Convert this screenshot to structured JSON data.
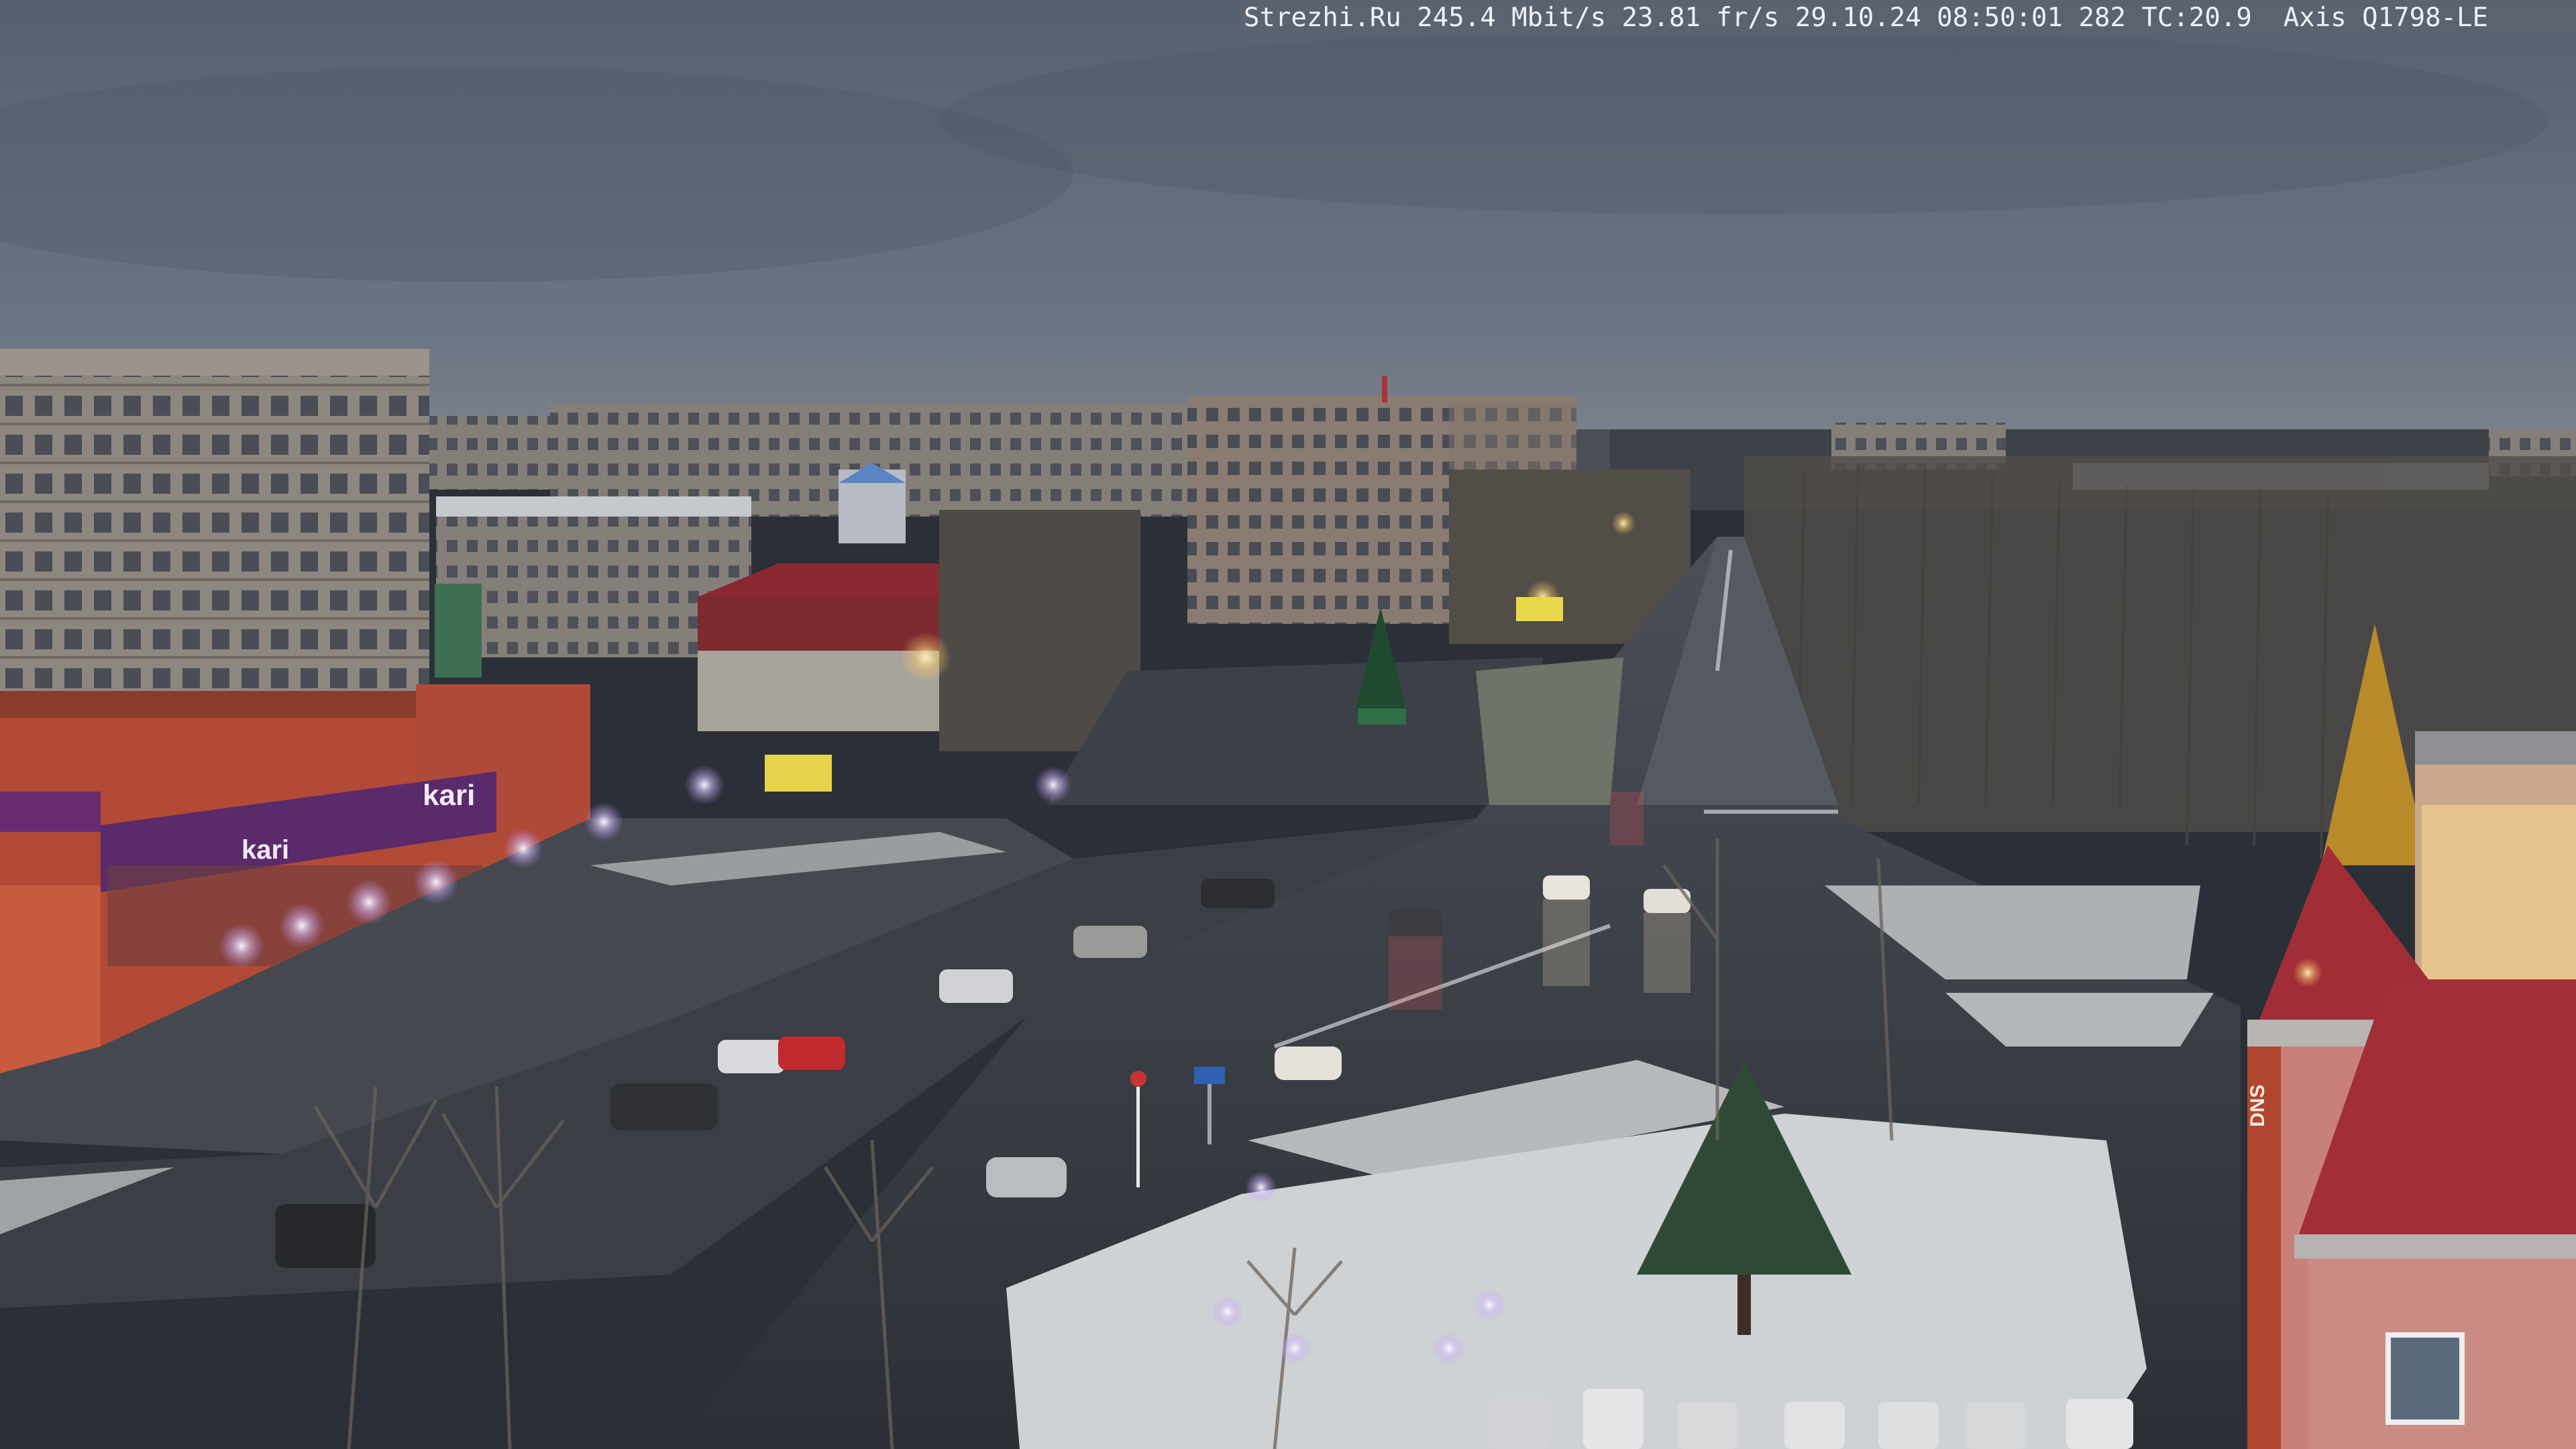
{
  "osd": {
    "site": "Strezhi.Ru",
    "bitrate": "245.4 Mbit/s",
    "framerate": "23.81 fr/s",
    "date": "29.10.24",
    "time": "08:50:01",
    "frame_counter": "282",
    "temperature": "TC:20.9",
    "camera_model": "Axis Q1798-LE"
  },
  "scene": {
    "signs": {
      "store_left": "kari",
      "store_main": "kari",
      "dns_tower": "DNS"
    }
  },
  "colors": {
    "sky": "#5f6878",
    "sky_horizon": "#7a8290",
    "asphalt": "#3a3e45",
    "wet_asphalt": "#2f3339",
    "snow": "#c9ccd0",
    "brick_red": "#b24a36",
    "store_purple": "#5a2a6a",
    "roof_red": "#9b2c2f",
    "street_light": "#f2c86b",
    "purple_light": "#b98cff"
  }
}
